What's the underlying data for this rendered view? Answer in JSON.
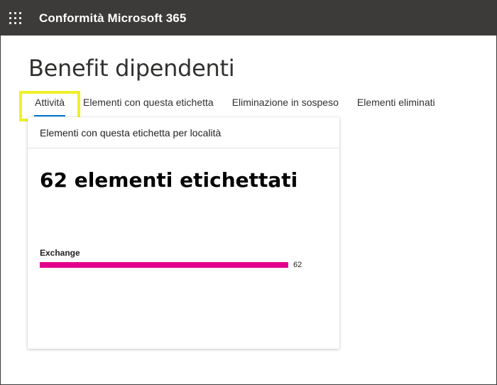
{
  "header": {
    "app_title": "Conformità Microsoft 365",
    "launcher_icon": "waffle-icon"
  },
  "page": {
    "title": "Benefit dipendenti"
  },
  "tabs": [
    {
      "label": "Attività",
      "active": true
    },
    {
      "label": "Elementi con questa etichetta",
      "active": false
    },
    {
      "label": "Eliminazione in sospeso",
      "active": false
    },
    {
      "label": "Elementi eliminati",
      "active": false
    }
  ],
  "card": {
    "title": "Elementi con questa etichetta per località",
    "total_text": "62 elementi etichettati"
  },
  "chart_data": {
    "type": "bar",
    "categories": [
      "Exchange"
    ],
    "values": [
      62
    ],
    "value_labels": [
      "62"
    ],
    "max": 62,
    "color": "#e3008c"
  },
  "colors": {
    "topbar": "#3d3b39",
    "highlight": "#f0f02a",
    "tab_underline": "#0078d4",
    "bar": "#e3008c"
  }
}
